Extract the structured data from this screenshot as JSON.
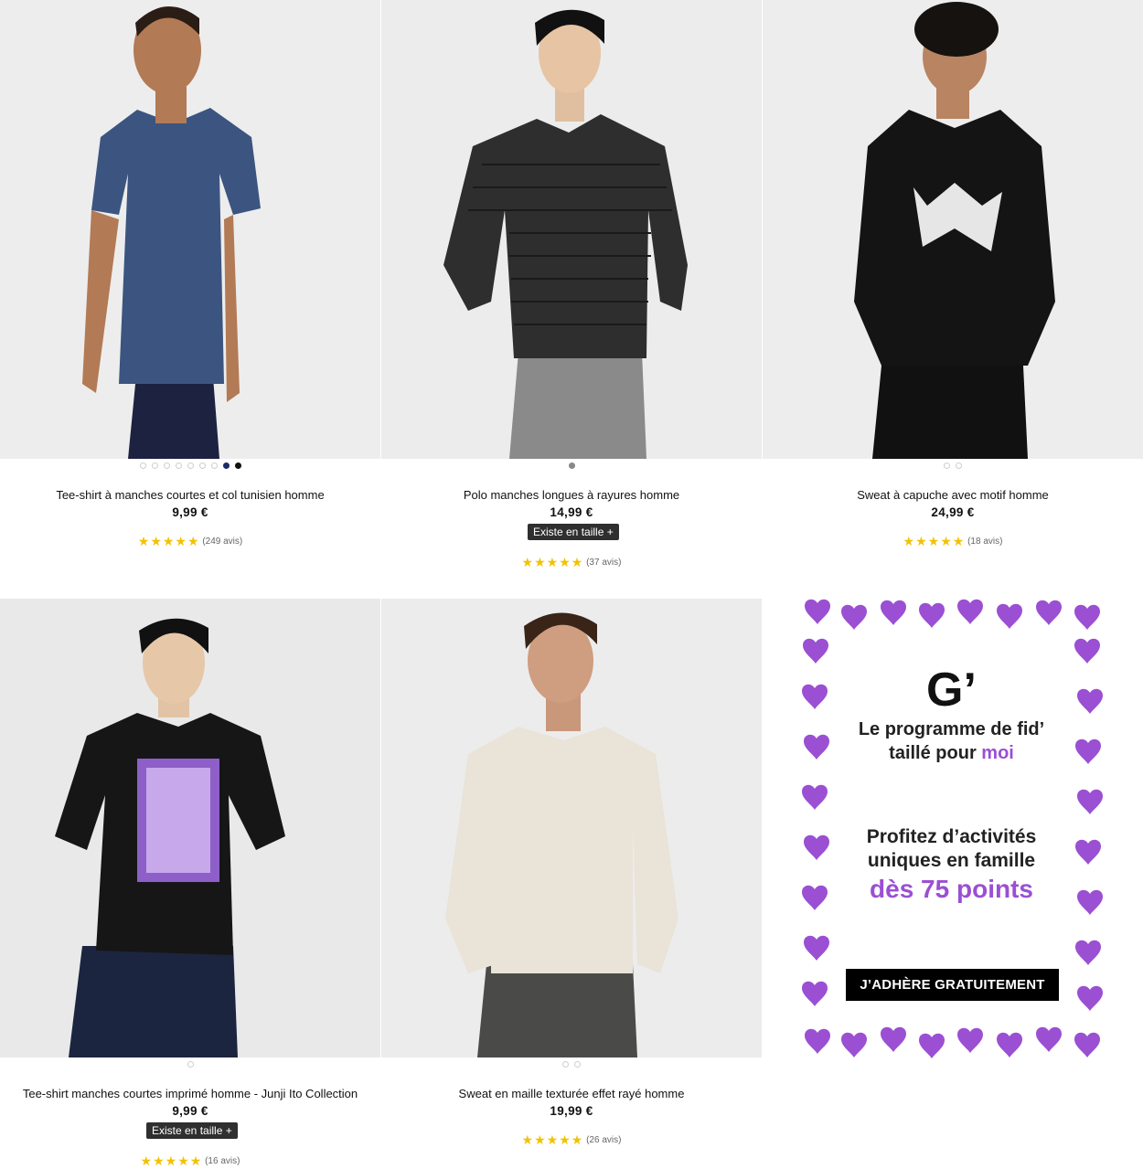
{
  "colors": {
    "star": "#f2c200",
    "promo_purple": "#9b4fd3",
    "dark_button": "#2f2f2f"
  },
  "products": [
    {
      "name": "Tee-shirt à manches courtes et col tunisien homme",
      "price": "9,99 €",
      "stars": "★★★★★",
      "rating": 4.5,
      "reviews": "(249 avis)",
      "size_label": ""
    },
    {
      "name": "Polo manches longues à rayures homme",
      "price": "14,99 €",
      "stars": "★★★★★",
      "rating": 5,
      "reviews": "(37 avis)",
      "size_label": "Existe en taille +"
    },
    {
      "name": "Sweat à capuche avec motif homme",
      "price": "24,99 €",
      "stars": "★★★★★",
      "rating": 5,
      "reviews": "(18 avis)",
      "size_label": ""
    },
    {
      "name": "Tee-shirt manches courtes imprimé homme - Junji Ito Collection",
      "price": "9,99 €",
      "stars": "★★★★★",
      "rating": 4.5,
      "reviews": "(16 avis)",
      "size_label": "Existe en taille +"
    },
    {
      "name": "Sweat en maille texturée effet rayé homme",
      "price": "19,99 €",
      "stars": "★★★★★",
      "rating": 5,
      "reviews": "(26 avis)",
      "size_label": ""
    }
  ],
  "promo": {
    "logo": "G’",
    "title_line1": "Le programme de fid’",
    "title_line2_start": "taillé pour ",
    "title_line2_accent": "moi",
    "sub_line1": "Profitez d’activités",
    "sub_line2": "uniques en famille",
    "points": "dès 75 points",
    "cta": "J’ADHÈRE GRATUITEMENT"
  }
}
